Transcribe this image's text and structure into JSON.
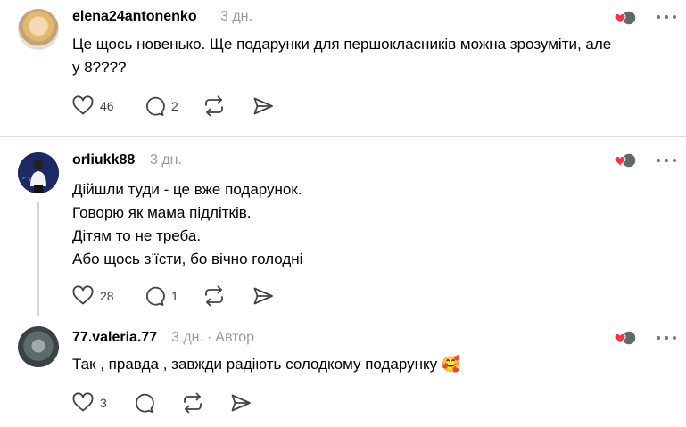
{
  "comments": [
    {
      "username": "elena24antonenko",
      "time": "3 дн.",
      "author_tag": "",
      "text_lines": [
        "Це щось новенько. Ще подарунки для першокласників можна зрозуміти, але",
        "у 8????"
      ],
      "likes": "46",
      "replies": "2"
    },
    {
      "username": "orliukk88",
      "time": "3 дн.",
      "author_tag": "",
      "text_lines": [
        "Дійшли туди - це вже подарунок.",
        "Говорю як мама підлітків.",
        "Дітям то не треба.",
        "Або щось з’їсти, бо вічно голодні"
      ],
      "likes": "28",
      "replies": "1"
    },
    {
      "username": "77.valeria.77",
      "time": "3 дн.",
      "author_tag": "Автор",
      "text_lines": [
        "Так , правда , завжди радіють солодкому подарунку 🥰"
      ],
      "likes": "3",
      "replies": ""
    }
  ],
  "icons": {
    "like": "heart-icon",
    "reply": "comment-icon",
    "repost": "repost-icon",
    "share": "send-icon",
    "more": "more-horizontal-icon",
    "liked_badge": "liked-by-author-badge"
  },
  "colors": {
    "heart": "#ff3040",
    "muted": "#999999",
    "divider": "#dbdbdb"
  }
}
